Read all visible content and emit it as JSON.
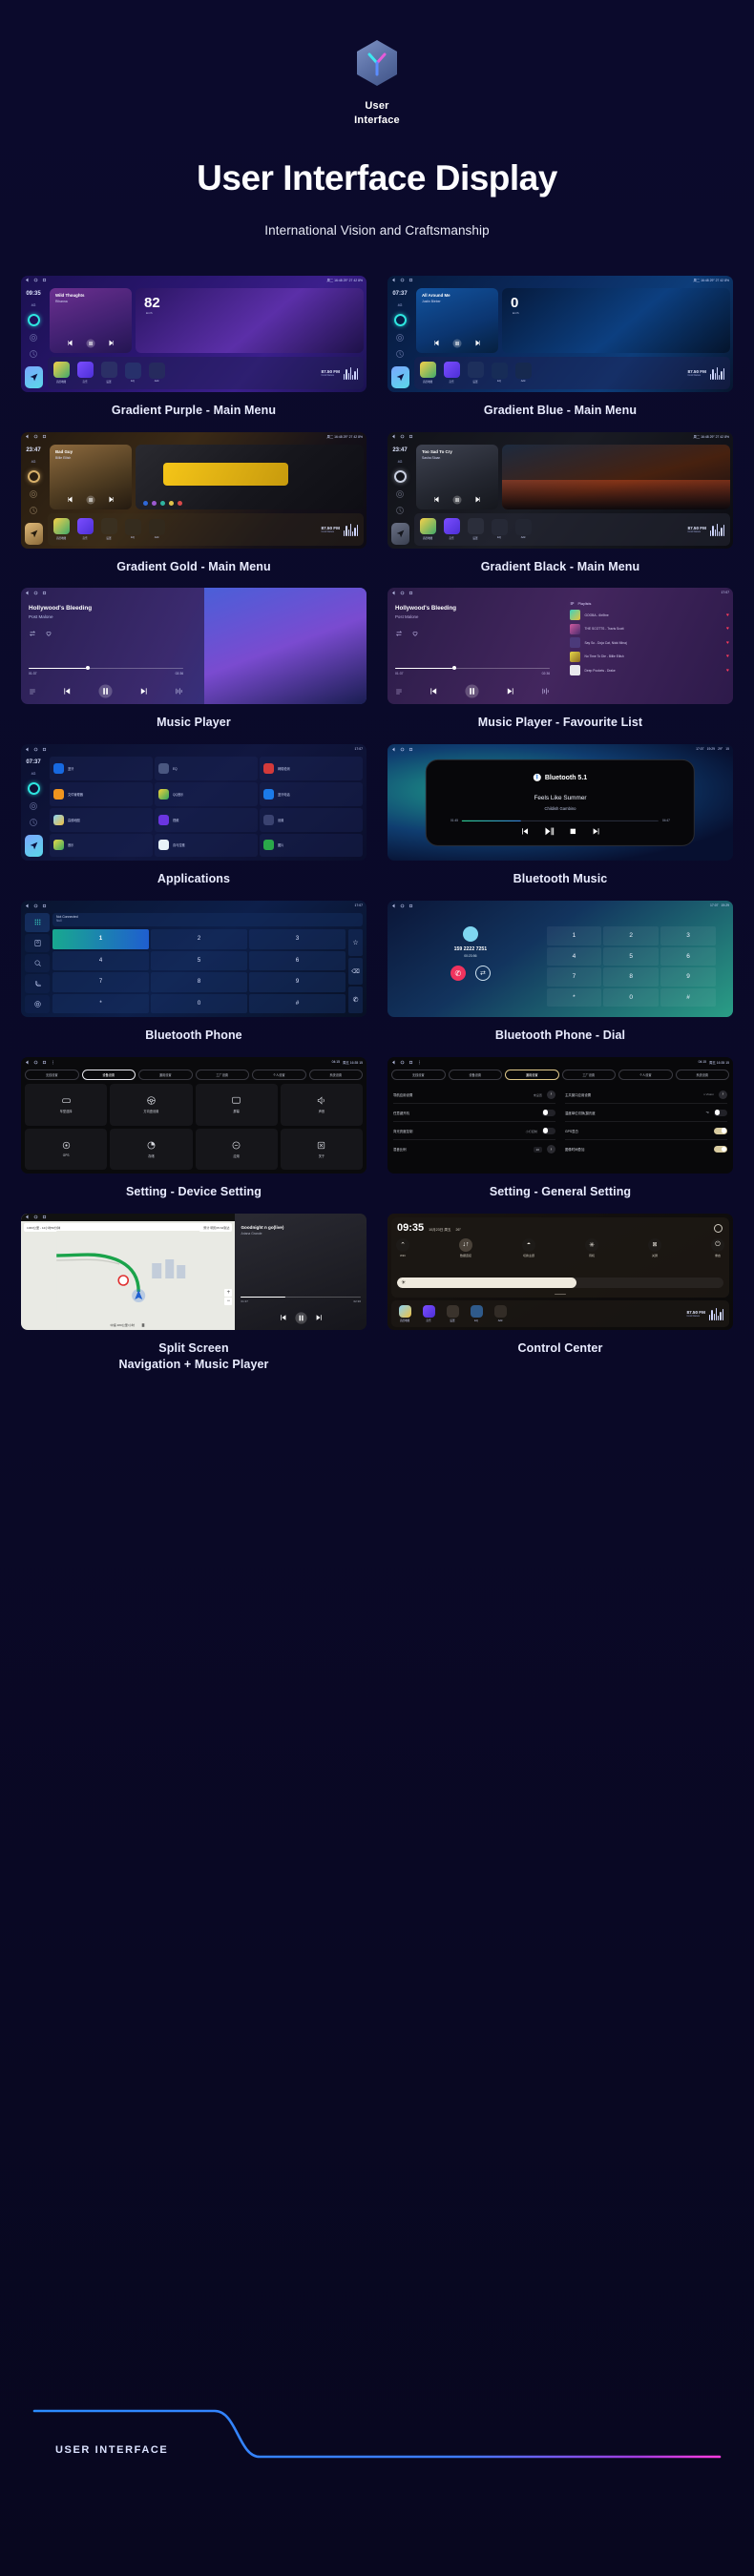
{
  "header": {
    "logo_icon": "hexagon-y-logo",
    "logo_line1": "User",
    "logo_line2": "Interface",
    "title": "User Interface Display",
    "subtitle": "International Vision and Craftsmanship"
  },
  "footer": {
    "label": "USER INTERFACE",
    "line_color_start": "#2b8cff",
    "line_color_end": "#ff3ce0"
  },
  "theme": {
    "background": "#0a0a2e",
    "caption_color": "#e9ecff",
    "accent_cyan": "#2ee6e0",
    "accent_purple": "#8b5cf6",
    "accent_magenta": "#ff3ce0"
  },
  "cards": [
    {
      "id": "gradient-purple-main-menu",
      "caption": "Gradient Purple - Main Menu",
      "status_time": "09:35",
      "rail_net": "4G",
      "statusbar_right": "周二 16:48   29°   27   42   8%",
      "widget_title": "Wild Thoughts",
      "widget_artist": "Rihanna",
      "speed_value": "82",
      "speed_unit": "km/h",
      "dock_label": "Application",
      "fm_freq": "87.50 FM",
      "fm_sub": "Cool Dance",
      "apps": [
        "高德地图",
        "音乐",
        "设置",
        "EQ",
        "Add"
      ]
    },
    {
      "id": "gradient-blue-main-menu",
      "caption": "Gradient Blue - Main Menu",
      "status_time": "07:37",
      "rail_net": "4G",
      "statusbar_right": "周二 16:48   29°   27   42   8%",
      "widget_title": "All Around Me",
      "widget_artist": "Justin Bieber",
      "speed_value": "0",
      "speed_unit": "km/h",
      "dock_label": "Application",
      "fm_freq": "87.50 FM",
      "fm_sub": "Cool Dance",
      "apps": [
        "高德地图",
        "音乐",
        "设置",
        "EQ",
        "Add"
      ]
    },
    {
      "id": "gradient-gold-main-menu",
      "caption": "Gradient Gold - Main Menu",
      "status_time": "23:47",
      "rail_net": "4G",
      "statusbar_right": "周二 16:48   29°   27   42   8%",
      "widget_title": "Bad Guy",
      "widget_artist": "Billie Eilish",
      "speed_value": "",
      "speed_unit": "",
      "dock_label": "Application",
      "fm_freq": "87.50 FM",
      "fm_sub": "Cool Dance",
      "apps": [
        "高德地图",
        "音乐",
        "设置",
        "EQ",
        "Add"
      ]
    },
    {
      "id": "gradient-black-main-menu",
      "caption": "Gradient Black - Main Menu",
      "status_time": "23:47",
      "rail_net": "4G",
      "statusbar_right": "周二 16:48   29°   27   42   8%",
      "widget_title": "Too Sad To Cry",
      "widget_artist": "Sasha Sloan",
      "speed_value": "",
      "speed_unit": "",
      "dock_label": "Application",
      "fm_freq": "87.50 FM",
      "fm_sub": "Cool Dance",
      "apps": [
        "高德地图",
        "音乐",
        "设置",
        "EQ",
        "Add"
      ]
    }
  ],
  "music_player": {
    "caption": "Music Player",
    "statusbar_time": "17:07",
    "statusbar_temp": "29°",
    "statusbar_battery": "15",
    "track_title": "Hollywood's Bleeding",
    "track_artist": "Post Malone",
    "elapsed": "01:37",
    "duration": "02:36",
    "progress_percent": 37,
    "controls": [
      "playlist-icon",
      "previous-icon",
      "pause-icon",
      "next-icon",
      "equalizer-icon"
    ]
  },
  "music_player_fav": {
    "caption": "Music Player - Favourite List",
    "statusbar_time": "17:07",
    "track_title": "Hollywood's Bleeding",
    "track_artist": "Post Malone",
    "elapsed": "01:37",
    "duration": "02:36",
    "progress_percent": 37,
    "playlist_header": "Playlists",
    "playlist": [
      "GOOBA - 6ix9ine",
      "THE SCOTTS - Travis Scott",
      "Say So - Doja Cat, Nicki Minaj",
      "No Time To Die - Billie Eilish",
      "Deep Pockets - Drake"
    ]
  },
  "applications": {
    "caption": "Applications",
    "status_time": "07:37",
    "rail_net": "4G",
    "apps": [
      "蓝牙",
      "EQ",
      "网络检测",
      "文件管理器",
      "QQ音乐",
      "蓝牙电话",
      "高德地图",
      "视频",
      "设置",
      "音乐",
      "喜马拉雅",
      "图片"
    ]
  },
  "bluetooth_music": {
    "caption": "Bluetooth Music",
    "statusbar_time": "17:07",
    "statusbar_clock": "19:29",
    "statusbar_temp": "29°",
    "statusbar_battery": "15",
    "bt_label": "Bluetooth 5.1",
    "track_title": "Feels  Like Summer",
    "track_artist": "Childish Gambino",
    "elapsed": "01:45",
    "duration": "04:47",
    "progress_percent": 30,
    "controls": [
      "previous-icon",
      "play-pause-icon",
      "stop-icon",
      "next-icon"
    ]
  },
  "bluetooth_phone": {
    "caption": "Bluetooth Phone",
    "connection_status": "Not Connected",
    "connection_sub": "Null",
    "sidebar_icons": [
      "dialpad-icon",
      "contacts-icon",
      "search-icon",
      "call-history-icon",
      "settings-icon"
    ],
    "keys": [
      "1",
      "2",
      "3",
      "4",
      "5",
      "6",
      "7",
      "8",
      "9",
      "*",
      "0",
      "#"
    ],
    "action_icons": [
      "star-icon",
      "backspace-icon",
      "call-icon"
    ]
  },
  "bluetooth_dial": {
    "caption": "Bluetooth Phone - Dial",
    "statusbar_time": "17:07",
    "statusbar_clock": "19:29",
    "number": "159 2222 7251",
    "duration": "00:23:56",
    "keys": [
      "1",
      "2",
      "3",
      "4",
      "5",
      "6",
      "7",
      "8",
      "9",
      "*",
      "0",
      "#"
    ],
    "end_call_icon": "hangup-icon",
    "swap_icon": "swap-audio-icon"
  },
  "setting_device": {
    "caption": "Setting - Device Setting",
    "statusbar_time": "04:15",
    "statusbar_right": "周五 16:35   15",
    "tabs": [
      "无线设置",
      "设备设置",
      "通用设置",
      "工厂设置",
      "个人设置",
      "系统设置"
    ],
    "active_tab": "设备设置",
    "tiles": [
      {
        "label": "车型选择",
        "icon": "car-model-icon"
      },
      {
        "label": "方向盘设置",
        "icon": "steering-wheel-icon"
      },
      {
        "label": "屏幕",
        "icon": "display-icon"
      },
      {
        "label": "声音",
        "icon": "volume-icon"
      },
      {
        "label": "GPS",
        "icon": "gps-icon"
      },
      {
        "label": "存储",
        "icon": "storage-icon"
      },
      {
        "label": "应用",
        "icon": "apps-icon"
      },
      {
        "label": "关于",
        "icon": "info-icon"
      }
    ]
  },
  "setting_general": {
    "caption": "Setting - General Setting",
    "statusbar_time": "04:15",
    "statusbar_right": "周五 16:35   15",
    "tabs": [
      "无线设置",
      "设备设置",
      "通用设置",
      "工厂设置",
      "个人设置",
      "系统设置"
    ],
    "active_tab": "通用设置",
    "rows_left": [
      {
        "label": "导航应用设置",
        "value": "未设置",
        "control": "chevron"
      },
      {
        "label": "任意键开机",
        "value": "",
        "control": "toggle-off"
      },
      {
        "label": "背光亮度控制",
        "value": "小灯控制",
        "control": "toggle-off"
      },
      {
        "label": "混音比例",
        "value": "10",
        "control": "chevron"
      }
    ],
    "rows_right": [
      {
        "label": "主共窗口应用设置",
        "value": "s Vision",
        "control": "chevron"
      },
      {
        "label": "温度单位切换(摄氏度",
        "value": "℃",
        "control": "toggle-off"
      },
      {
        "label": "GPS显白",
        "value": "",
        "control": "toggle-on"
      },
      {
        "label": "图像时间叠加",
        "value": "",
        "control": "toggle-on"
      }
    ]
  },
  "split_screen": {
    "caption_line1": "Split Screen",
    "caption_line2": "Navigation + Music Player",
    "nav_distance": "1063公里 - 12小时59分钟",
    "nav_eta": "预计 明天05:34到达",
    "nav_speed": "16:25",
    "nav_bottom": "中速 480公里/小时",
    "track_title": "Goodnight n go(live)",
    "track_artist": "Ariana Grande",
    "elapsed": "01:37",
    "duration": "02:36"
  },
  "control_center": {
    "caption": "Control Center",
    "time": "09:35",
    "date": "10月23日 周五",
    "temp": "26°",
    "gear_icon": "settings-gear-icon",
    "toggles": [
      {
        "label": "WiFi",
        "icon": "wifi-icon",
        "active": false
      },
      {
        "label": "数据连接",
        "icon": "data-icon",
        "active": true
      },
      {
        "label": "切换主题",
        "icon": "theme-icon",
        "active": false
      },
      {
        "label": "待机",
        "icon": "standby-icon",
        "active": false
      },
      {
        "label": "关屏",
        "icon": "screen-off-icon",
        "active": false
      },
      {
        "label": "重启",
        "icon": "restart-icon",
        "active": false
      }
    ],
    "brightness_percent": 55,
    "brightness_icon": "brightness-icon",
    "fm_freq": "87.50 FM",
    "fm_sub": "Cool Dance",
    "apps": [
      "高德地图",
      "音乐",
      "设置",
      "EQ",
      "Add"
    ]
  }
}
